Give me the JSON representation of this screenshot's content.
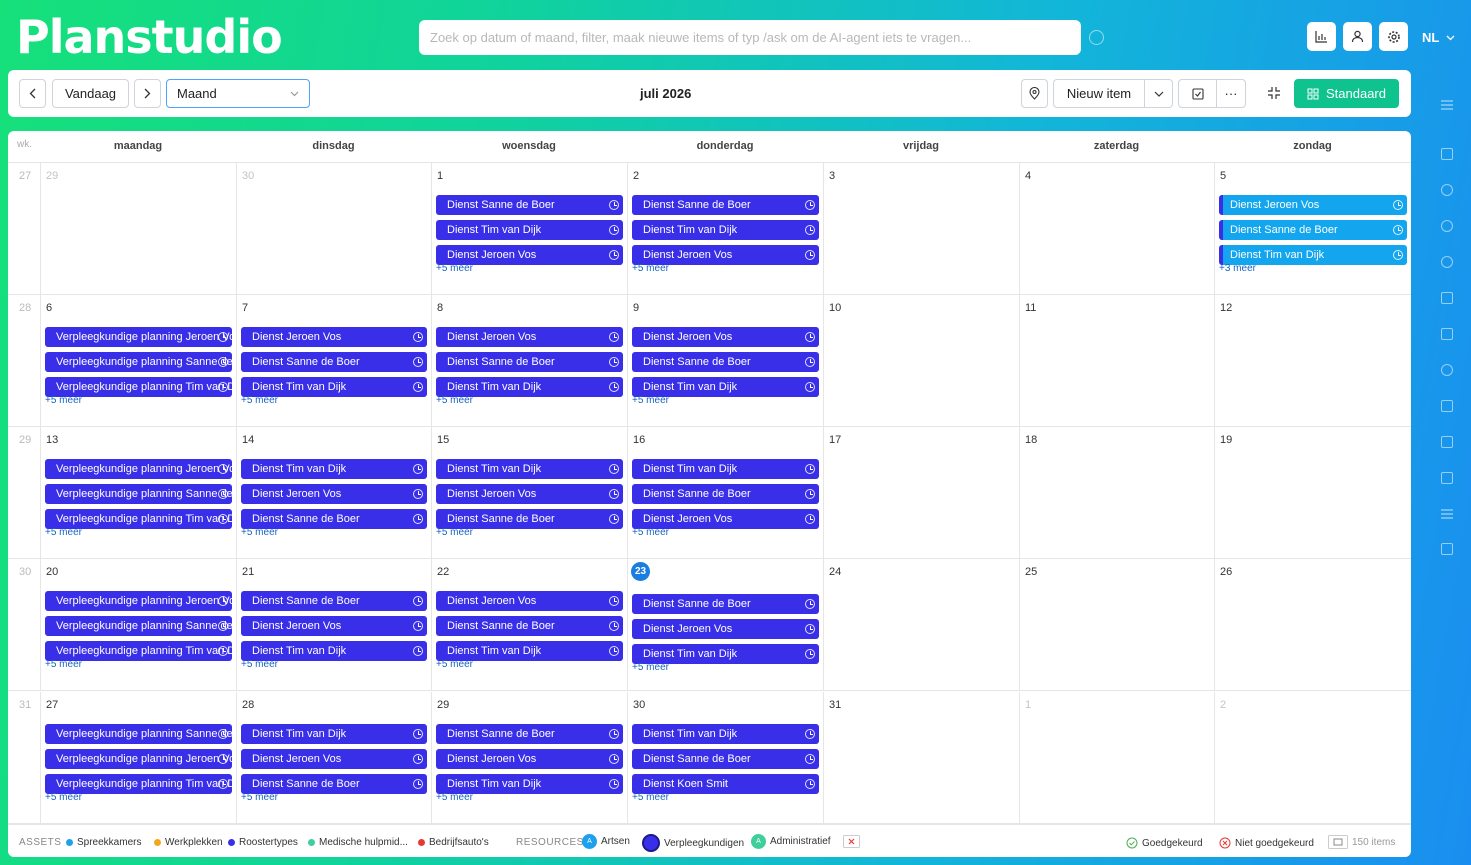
{
  "app": {
    "logo": "Planstudio",
    "search_placeholder": "Zoek op datum of maand, filter, maak nieuwe items of typ /ask om de AI-agent iets te vragen...",
    "language": "NL"
  },
  "toolbar": {
    "today_label": "Vandaag",
    "view_label": "Maand",
    "month_title": "juli 2026",
    "new_item_label": "Nieuw item",
    "more_label": "···",
    "standard_label": "Standaard"
  },
  "calendar": {
    "week_header": "wk.",
    "days": [
      "maandag",
      "dinsdag",
      "woensdag",
      "donderdag",
      "vrijdag",
      "zaterdag",
      "zondag"
    ],
    "weeks": [
      {
        "wk": "27",
        "cells": [
          {
            "date": "29",
            "other": true,
            "events": [],
            "more": ""
          },
          {
            "date": "30",
            "other": true,
            "events": [],
            "more": ""
          },
          {
            "date": "1",
            "events": [
              "Dienst Sanne de Boer",
              "Dienst Tim van Dijk",
              "Dienst Jeroen Vos"
            ],
            "more": "+5 meer"
          },
          {
            "date": "2",
            "events": [
              "Dienst Sanne de Boer",
              "Dienst Tim van Dijk",
              "Dienst Jeroen Vos"
            ],
            "more": "+5 meer"
          },
          {
            "date": "3",
            "events": [],
            "more": ""
          },
          {
            "date": "4",
            "events": [],
            "more": ""
          },
          {
            "date": "5",
            "cyan": true,
            "events": [
              "Dienst Jeroen Vos",
              "Dienst Sanne de Boer",
              "Dienst Tim van Dijk"
            ],
            "more": "+3 meer"
          }
        ]
      },
      {
        "wk": "28",
        "cells": [
          {
            "date": "6",
            "events": [
              "Verpleegkundige planning Jeroen Vos",
              "Verpleegkundige planning Sanne de Boer",
              "Verpleegkundige planning Tim van Dijk"
            ],
            "more": "+5 meer"
          },
          {
            "date": "7",
            "events": [
              "Dienst Jeroen Vos",
              "Dienst Sanne de Boer",
              "Dienst Tim van Dijk"
            ],
            "more": "+5 meer"
          },
          {
            "date": "8",
            "events": [
              "Dienst Jeroen Vos",
              "Dienst Sanne de Boer",
              "Dienst Tim van Dijk"
            ],
            "more": "+5 meer"
          },
          {
            "date": "9",
            "events": [
              "Dienst Jeroen Vos",
              "Dienst Sanne de Boer",
              "Dienst Tim van Dijk"
            ],
            "more": "+5 meer"
          },
          {
            "date": "10",
            "events": [],
            "more": ""
          },
          {
            "date": "11",
            "events": [],
            "more": ""
          },
          {
            "date": "12",
            "events": [],
            "more": ""
          }
        ]
      },
      {
        "wk": "29",
        "cells": [
          {
            "date": "13",
            "events": [
              "Verpleegkundige planning Jeroen Vos",
              "Verpleegkundige planning Sanne de Boer",
              "Verpleegkundige planning Tim van Dijk"
            ],
            "more": "+5 meer"
          },
          {
            "date": "14",
            "events": [
              "Dienst Tim van Dijk",
              "Dienst Jeroen Vos",
              "Dienst Sanne de Boer"
            ],
            "more": "+5 meer"
          },
          {
            "date": "15",
            "events": [
              "Dienst Tim van Dijk",
              "Dienst Jeroen Vos",
              "Dienst Sanne de Boer"
            ],
            "more": "+5 meer"
          },
          {
            "date": "16",
            "events": [
              "Dienst Tim van Dijk",
              "Dienst Sanne de Boer",
              "Dienst Jeroen Vos"
            ],
            "more": "+5 meer"
          },
          {
            "date": "17",
            "events": [],
            "more": ""
          },
          {
            "date": "18",
            "events": [],
            "more": ""
          },
          {
            "date": "19",
            "events": [],
            "more": ""
          }
        ]
      },
      {
        "wk": "30",
        "cells": [
          {
            "date": "20",
            "events": [
              "Verpleegkundige planning Jeroen Vos",
              "Verpleegkundige planning Sanne de Boer",
              "Verpleegkundige planning Tim van Dijk"
            ],
            "more": "+5 meer"
          },
          {
            "date": "21",
            "events": [
              "Dienst Sanne de Boer",
              "Dienst Jeroen Vos",
              "Dienst Tim van Dijk"
            ],
            "more": "+5 meer"
          },
          {
            "date": "22",
            "events": [
              "Dienst Jeroen Vos",
              "Dienst Sanne de Boer",
              "Dienst Tim van Dijk"
            ],
            "more": "+5 meer"
          },
          {
            "date": "23",
            "today": true,
            "events": [
              "Dienst Sanne de Boer",
              "Dienst Jeroen Vos",
              "Dienst Tim van Dijk"
            ],
            "more": "+5 meer"
          },
          {
            "date": "24",
            "events": [],
            "more": ""
          },
          {
            "date": "25",
            "events": [],
            "more": ""
          },
          {
            "date": "26",
            "events": [],
            "more": ""
          }
        ]
      },
      {
        "wk": "31",
        "cells": [
          {
            "date": "27",
            "events": [
              "Verpleegkundige planning Sanne de Boer",
              "Verpleegkundige planning Jeroen Vos",
              "Verpleegkundige planning Tim van Dijk"
            ],
            "more": "+5 meer"
          },
          {
            "date": "28",
            "events": [
              "Dienst Tim van Dijk",
              "Dienst Jeroen Vos",
              "Dienst Sanne de Boer"
            ],
            "more": "+5 meer"
          },
          {
            "date": "29",
            "events": [
              "Dienst Sanne de Boer",
              "Dienst Jeroen Vos",
              "Dienst Tim van Dijk"
            ],
            "more": "+5 meer"
          },
          {
            "date": "30",
            "events": [
              "Dienst Tim van Dijk",
              "Dienst Sanne de Boer",
              "Dienst Koen Smit"
            ],
            "more": "+5 meer"
          },
          {
            "date": "31",
            "events": [],
            "more": ""
          },
          {
            "date": "1",
            "other": true,
            "events": [],
            "more": ""
          },
          {
            "date": "2",
            "other": true,
            "events": [],
            "more": ""
          }
        ]
      }
    ]
  },
  "footer": {
    "assets_label": "ASSETS",
    "assets": [
      {
        "label": "Spreekkamers",
        "color": "#1ea0ee"
      },
      {
        "label": "Werkplekken",
        "color": "#f2a81d"
      },
      {
        "label": "Roostertypes",
        "color": "#3a2fe8"
      },
      {
        "label": "Medische hulpmid...",
        "color": "#3fcf9a"
      },
      {
        "label": "Bedrijfsauto's",
        "color": "#e53935"
      }
    ],
    "resources_label": "RESOURCES",
    "resources": [
      {
        "label": "Artsen",
        "initial": "A",
        "color": "#1ea0ee"
      },
      {
        "label": "Verpleegkundigen",
        "initial": "",
        "color": "#3a2fe8"
      },
      {
        "label": "Administratief",
        "initial": "A",
        "color": "#3fcf9a"
      }
    ],
    "approved_label": "Goedgekeurd",
    "not_approved_label": "Niet goedgekeurd",
    "items_count": "150 items"
  }
}
